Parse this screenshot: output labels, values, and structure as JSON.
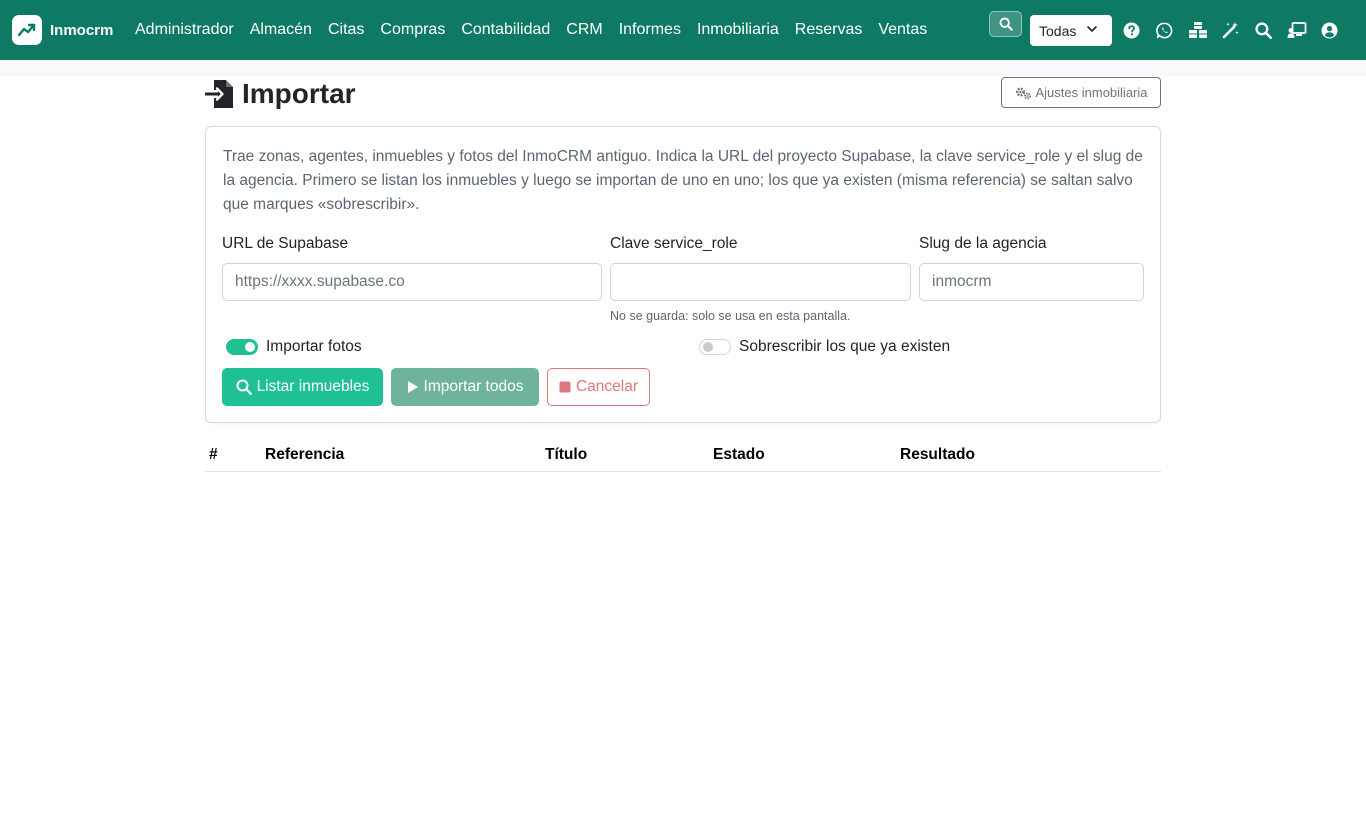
{
  "app": {
    "brand_name": "Inmocrm",
    "brand_icon": "trending-up-icon",
    "accent_color": "#0f7a63"
  },
  "menu": [
    {
      "label": "Administrador"
    },
    {
      "label": "Almacén"
    },
    {
      "label": "Citas"
    },
    {
      "label": "Compras"
    },
    {
      "label": "Contabilidad"
    },
    {
      "label": "CRM"
    },
    {
      "label": "Informes"
    },
    {
      "label": "Inmobiliaria"
    },
    {
      "label": "Reservas"
    },
    {
      "label": "Ventas"
    }
  ],
  "toolbar": {
    "search_icon": "search-icon",
    "scope_value": "Todas",
    "icons": [
      "help-icon",
      "whatsapp-icon",
      "cubes-icon",
      "magic-wand-icon",
      "search-icon",
      "chalkboard-user-icon",
      "user-icon"
    ]
  },
  "page": {
    "title": "Importar",
    "title_icon": "file-import-icon",
    "settings_button": "Ajustes inmobiliaria"
  },
  "card": {
    "description": "Trae zonas, agentes, inmuebles y fotos del InmoCRM antiguo. Indica la URL del proyecto Supabase, la clave service_role y el slug de la agencia. Primero se listan los inmuebles y luego se importan de uno en uno; los que ya existen (misma referencia) se saltan salvo que marques «sobrescribir».",
    "fields": {
      "url": {
        "label": "URL de Supabase",
        "placeholder": "https://xxxx.supabase.co",
        "value": ""
      },
      "key": {
        "label": "Clave service_role",
        "placeholder": "",
        "value": "",
        "help": "No se guarda: solo se usa en esta pantalla."
      },
      "slug": {
        "label": "Slug de la agencia",
        "placeholder": "inmocrm",
        "value": ""
      }
    },
    "toggles": {
      "photos": {
        "label": "Importar fotos",
        "checked": true
      },
      "overwrite": {
        "label": "Sobrescribir los que ya existen",
        "checked": false
      }
    },
    "buttons": {
      "list": "Listar inmuebles",
      "import_all": "Importar todos",
      "cancel": "Cancelar"
    }
  },
  "table": {
    "headers": [
      "#",
      "Referencia",
      "Título",
      "Estado",
      "Resultado"
    ],
    "rows": []
  }
}
